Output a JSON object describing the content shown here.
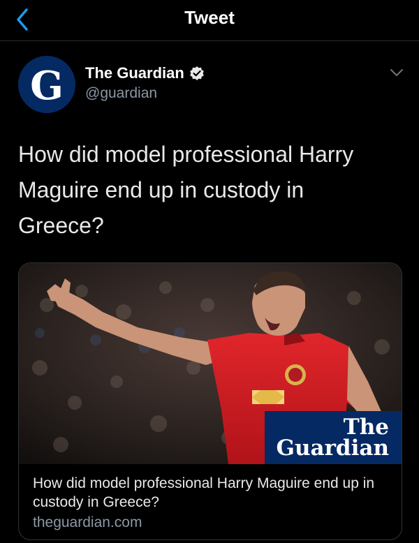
{
  "header": {
    "title": "Tweet",
    "back_icon": "chevron-left-icon"
  },
  "author": {
    "name": "The Guardian",
    "handle": "@guardian",
    "avatar_letter": "G",
    "verified": true
  },
  "tweet": {
    "text": "How did model professional Harry Maguire end up in custody in Greece?"
  },
  "card": {
    "image_alt": "Harry Maguire gesturing in a red Manchester United shirt",
    "logo_line1": "The",
    "logo_line2": "Guardian",
    "title": "How did model professional Harry Maguire end up in custody in Greece?",
    "domain": "theguardian.com"
  },
  "colors": {
    "background": "#000000",
    "accent": "#1d9bf0",
    "guardian_blue": "#052962",
    "muted_text": "#8b98a5"
  }
}
